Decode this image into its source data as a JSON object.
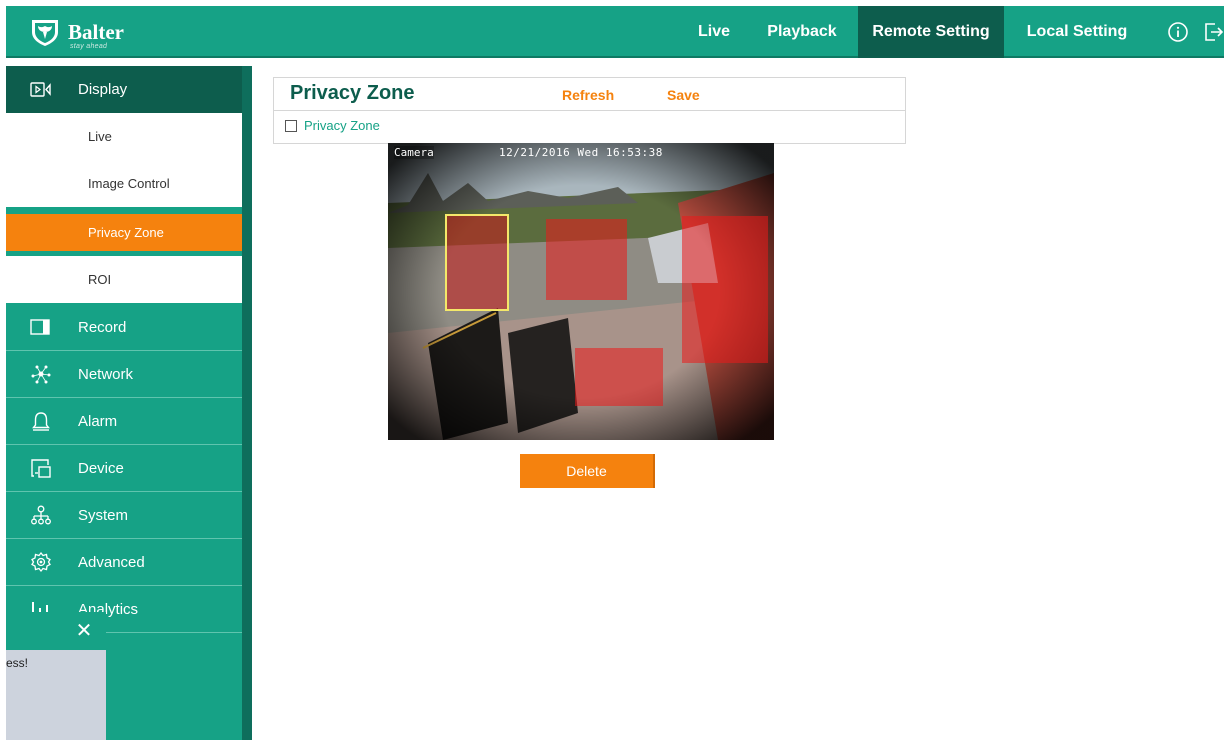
{
  "header": {
    "brand": "Balter",
    "tagline": "stay ahead",
    "nav": {
      "live": "Live",
      "playback": "Playback",
      "remote_setting": "Remote Setting",
      "local_setting": "Local Setting"
    },
    "icons": {
      "info": "info-icon",
      "logout": "logout-icon"
    },
    "active_tab": "Remote Setting"
  },
  "sidebar": {
    "display": {
      "label": "Display",
      "icon": "display-icon",
      "sub_items": [
        "Live",
        "Image Control",
        "Privacy Zone",
        "ROI"
      ],
      "active": "Privacy Zone"
    },
    "items": [
      {
        "label": "Record",
        "icon": "record-icon"
      },
      {
        "label": "Network",
        "icon": "network-icon"
      },
      {
        "label": "Alarm",
        "icon": "alarm-icon"
      },
      {
        "label": "Device",
        "icon": "device-icon"
      },
      {
        "label": "System",
        "icon": "system-icon"
      },
      {
        "label": "Advanced",
        "icon": "advanced-icon"
      },
      {
        "label": "Analytics",
        "icon": "analytics-icon"
      }
    ]
  },
  "toast": {
    "message": "ess!",
    "close": "✕"
  },
  "main": {
    "title": "Privacy Zone",
    "refresh_label": "Refresh",
    "save_label": "Save",
    "privacy_zone_checkbox": {
      "label": "Privacy Zone",
      "checked": false
    },
    "video": {
      "osd_camera": "Camera",
      "osd_datetime": "12/21/2016 Wed 16:53:38"
    },
    "delete_label": "Delete"
  },
  "colors": {
    "primary": "#16a286",
    "primary_dark": "#0d5d4d",
    "accent": "#f5820e",
    "zone_fill": "#eb1919",
    "zone_selected_border": "#f4e86a"
  }
}
